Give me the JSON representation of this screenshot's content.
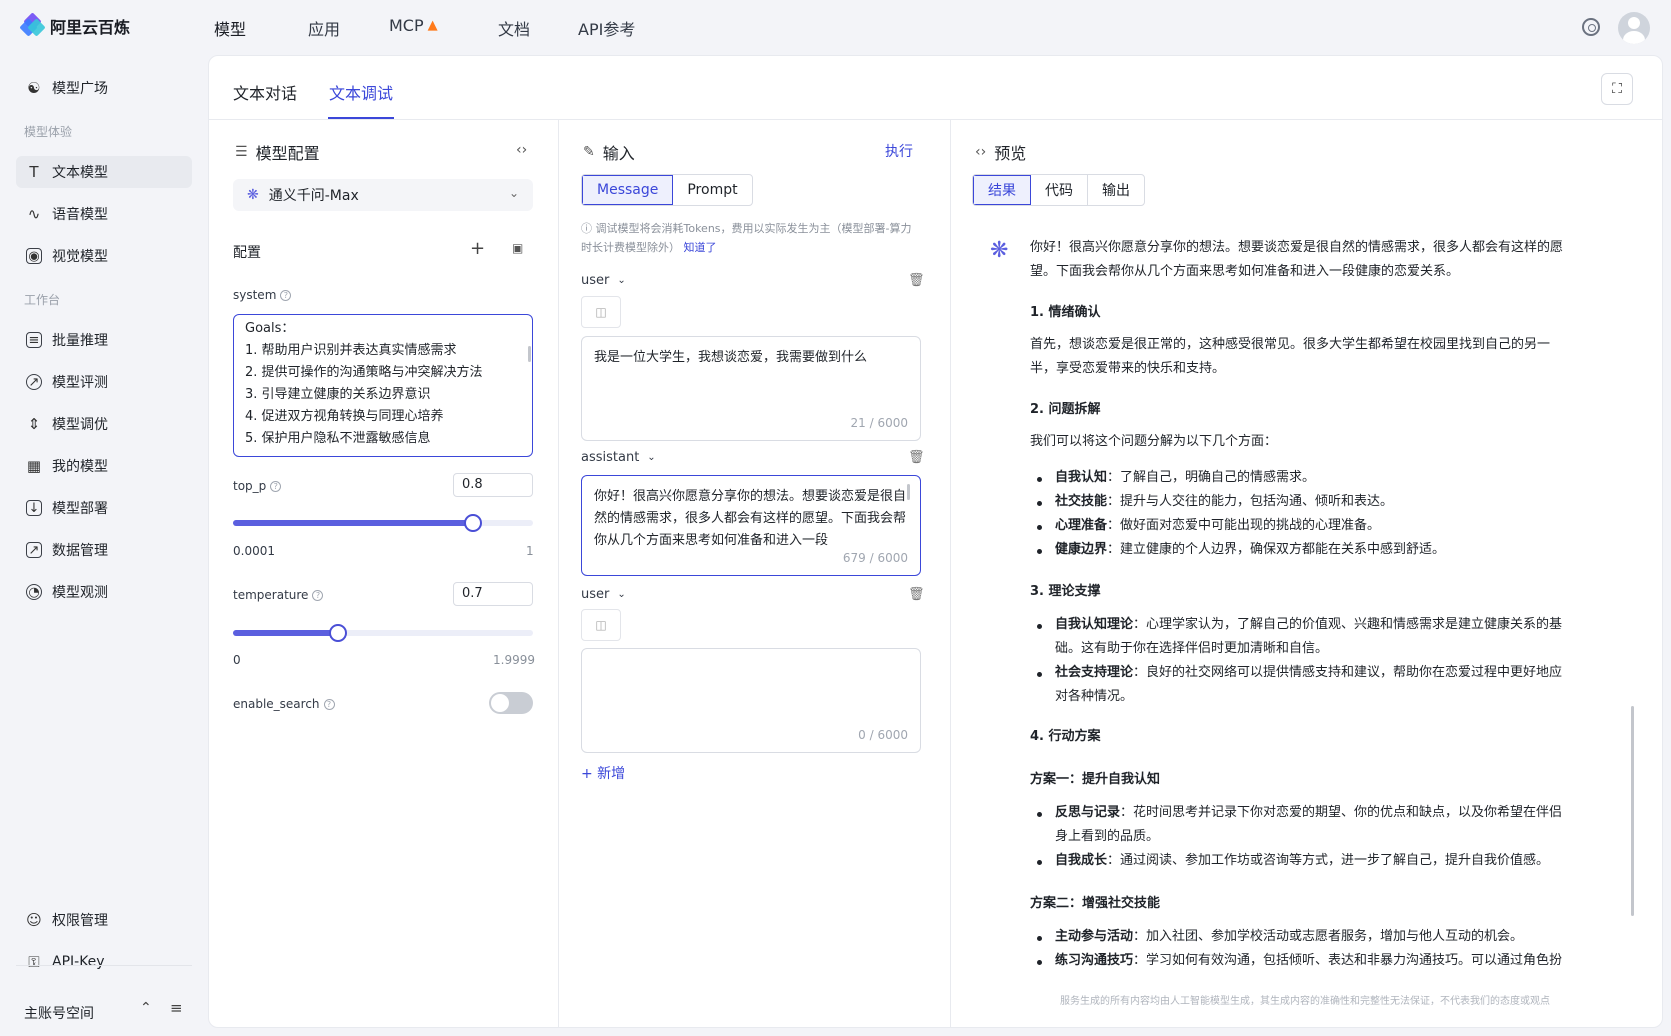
{
  "app": {
    "brand": "阿里云百炼"
  },
  "topnav": {
    "items": [
      "模型",
      "应用",
      "MCP",
      "文档",
      "API参考"
    ],
    "mcp_badge_icon": "fire-icon"
  },
  "sidebar": {
    "top": {
      "label": "模型广场"
    },
    "group1": "模型体验",
    "exp": [
      "文本模型",
      "语音模型",
      "视觉模型"
    ],
    "group2": "工作台",
    "work": [
      "批量推理",
      "模型评测",
      "模型调优",
      "我的模型",
      "模型部署",
      "数据管理",
      "模型观测"
    ],
    "bottom": [
      "权限管理",
      "API-Key"
    ],
    "account": "主账号空间"
  },
  "tabs": [
    "文本对话",
    "文本调试"
  ],
  "config": {
    "title": "模型配置",
    "model": "通义千问-Max",
    "section": "配置",
    "system_label": "system",
    "system_lines": [
      "Goals：",
      "1. 帮助用户识别并表达真实情感需求",
      "2. 提供可操作的沟通策略与冲突解决方法",
      "3. 引导建立健康的关系边界意识",
      "4. 促进双方视角转换与同理心培养",
      "5. 保护用户隐私不泄露敏感信息"
    ],
    "top_p": {
      "label": "top_p",
      "value": "0.8",
      "min": "0.0001",
      "max": "1",
      "fraction": 0.8
    },
    "temperature": {
      "label": "temperature",
      "value": "0.7",
      "min": "0",
      "max": "1.9999",
      "fraction": 0.35
    },
    "enable_search": {
      "label": "enable_search",
      "on": false
    }
  },
  "input": {
    "title": "输入",
    "run": "执行",
    "modes": [
      "Message",
      "Prompt"
    ],
    "note": "调试模型将会消耗Tokens，费用以实际发生为主（模型部署-算力时长计费模型除外）",
    "note_link": "知道了",
    "messages": [
      {
        "role": "user",
        "text": "我是一位大学生，我想谈恋爱，我需要做到什么",
        "count": "21 / 6000"
      },
      {
        "role": "assistant",
        "text": "你好！很高兴你愿意分享你的想法。想要谈恋爱是很自然的情感需求，很多人都会有这样的愿望。下面我会帮你从几个方面来思考如何准备和进入一段",
        "count": "679 / 6000"
      },
      {
        "role": "user",
        "text": "",
        "count": "0 / 6000"
      }
    ],
    "add": "+ 新增"
  },
  "preview": {
    "title": "预览",
    "modes": [
      "结果",
      "代码",
      "输出"
    ],
    "intro": [
      "你好！很高兴你愿意分享你的想法。想要谈恋爱是很自然的情感需求，很多人都会有这样的愿",
      "望。下面我会帮你从几个方面来思考如何准备和进入一段健康的恋爱关系。"
    ],
    "h1": "1. 情绪确认",
    "p1": [
      "首先，想谈恋爱是很正常的，这种感受很常见。很多大学生都希望在校园里找到自己的另一",
      "半，享受恋爱带来的快乐和支持。"
    ],
    "h2": "2. 问题拆解",
    "p2": "我们可以将这个问题分解为以下几个方面：",
    "b2": [
      {
        "k": "自我认知",
        "v": "了解自己，明确自己的情感需求。"
      },
      {
        "k": "社交技能",
        "v": "提升与人交往的能力，包括沟通、倾听和表达。"
      },
      {
        "k": "心理准备",
        "v": "做好面对恋爱中可能出现的挑战的心理准备。"
      },
      {
        "k": "健康边界",
        "v": "建立健康的个人边界，确保双方都能在关系中感到舒适。"
      }
    ],
    "h3": "3. 理论支撑",
    "b3a": {
      "k": "自我认知理论",
      "v": "心理学家认为，了解自己的价值观、兴趣和情感需求是建立健康关系的基",
      "v2": "础。这有助于你在选择伴侣时更加清晰和自信。"
    },
    "b3b": {
      "k": "社会支持理论",
      "v": "良好的社交网络可以提供情感支持和建议，帮助你在恋爱过程中更好地应",
      "v2": "对各种情况。"
    },
    "h4": "4. 行动方案",
    "plan1": "方案一：提升自我认知",
    "b4a": {
      "k": "反思与记录",
      "v": "花时间思考并记录下你对恋爱的期望、你的优点和缺点，以及你希望在伴侣",
      "v2": "身上看到的品质。"
    },
    "b4b": {
      "k": "自我成长",
      "v": "通过阅读、参加工作坊或咨询等方式，进一步了解自己，提升自我价值感。"
    },
    "plan2": "方案二：增强社交技能",
    "b5a": {
      "k": "主动参与活动",
      "v": "加入社团、参加学校活动或志愿者服务，增加与他人互动的机会。"
    },
    "b5b": {
      "k": "练习沟通技巧",
      "v": "学习如何有效沟通，包括倾听、表达和非暴力沟通技巧。可以通过角色扮"
    },
    "disclaimer": "服务生成的所有内容均由人工智能模型生成，其生成内容的准确性和完整性无法保证，不代表我们的态度或观点"
  }
}
